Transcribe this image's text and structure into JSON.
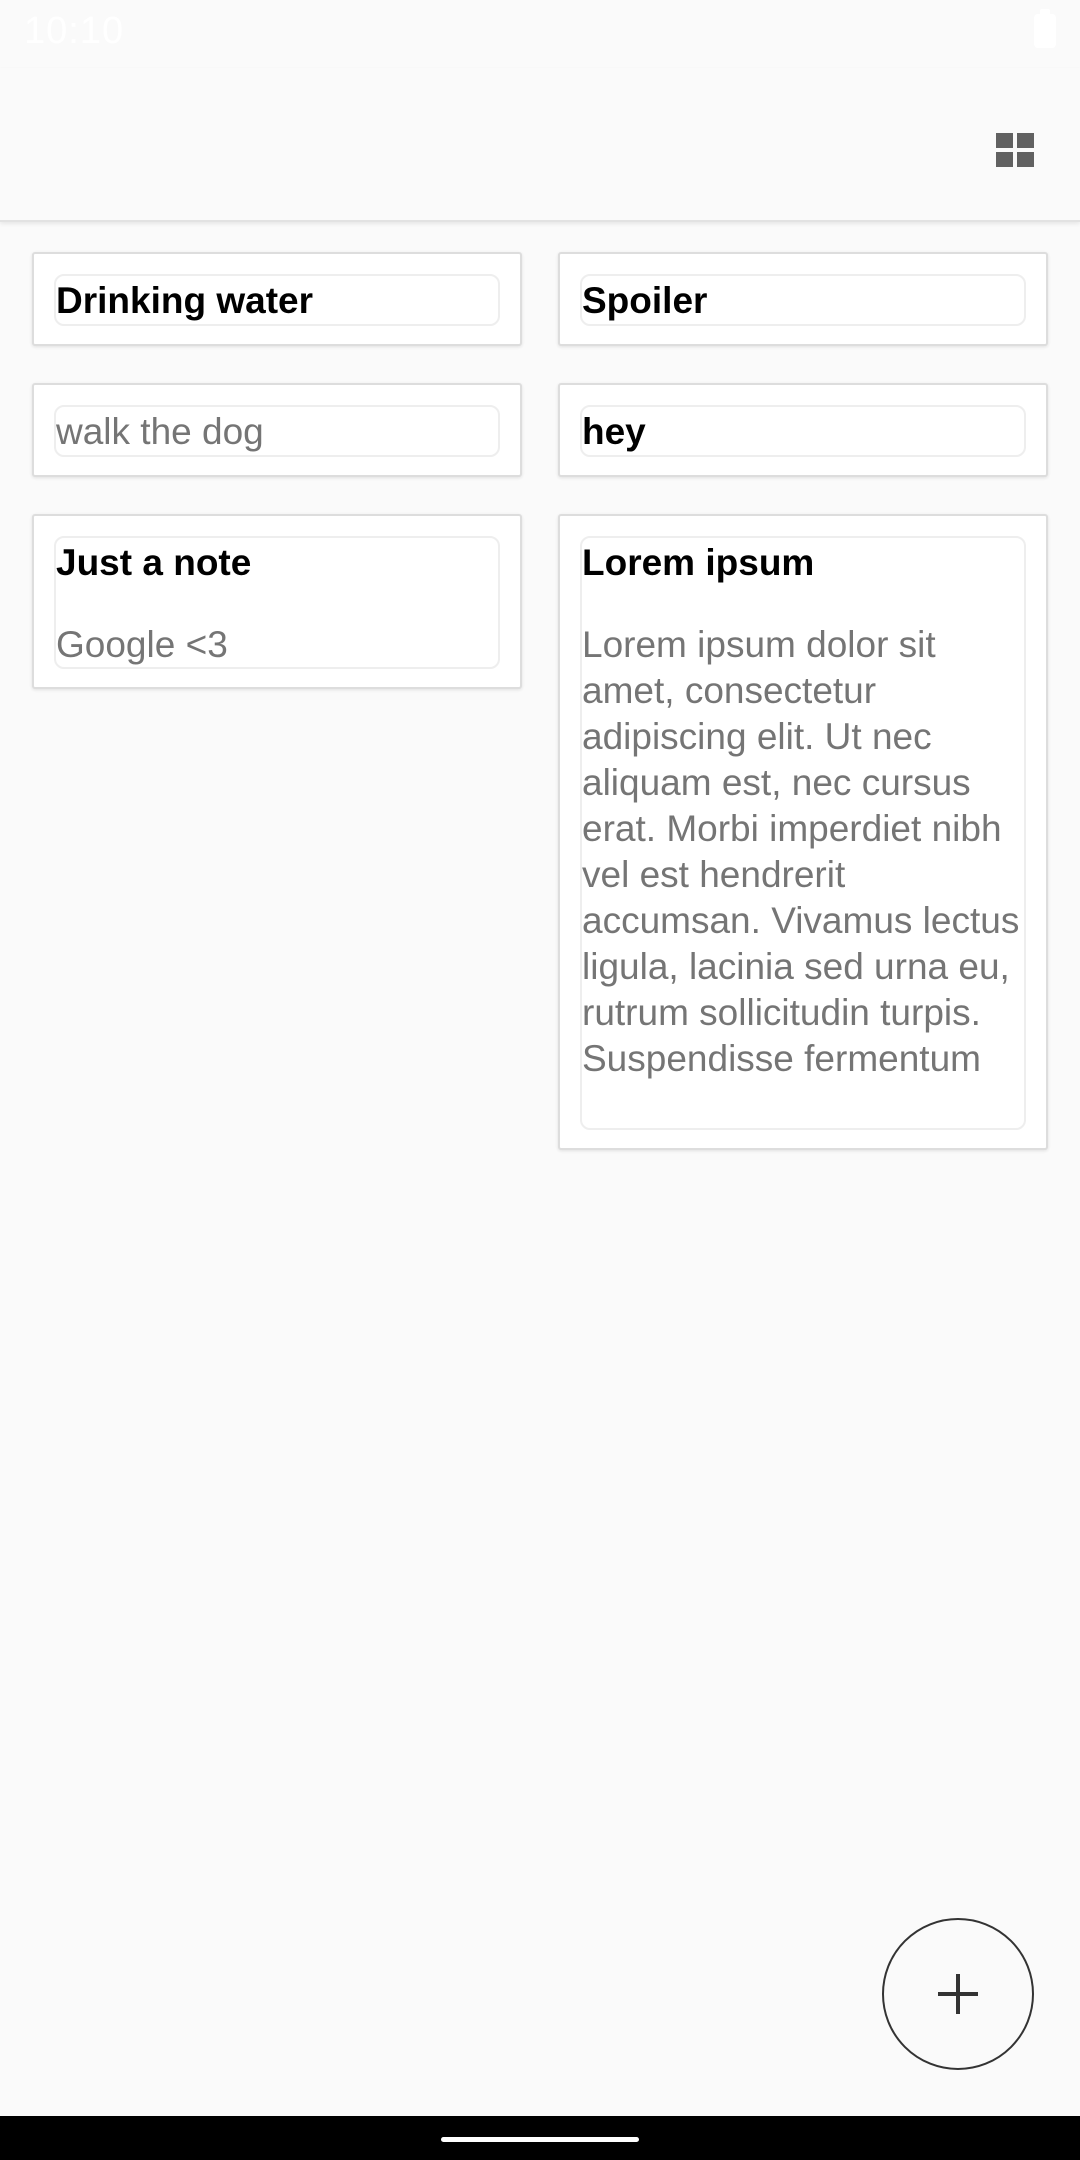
{
  "status_bar": {
    "time": "10:10",
    "battery_icon": "battery-full-icon"
  },
  "app_bar": {
    "view_toggle_icon": "grid-view-icon"
  },
  "notes": [
    {
      "title": "Drinking water",
      "body": ""
    },
    {
      "title": "Spoiler",
      "body": ""
    },
    {
      "title": "",
      "body": "walk the dog"
    },
    {
      "title": "hey",
      "body": ""
    },
    {
      "title": "Just a note",
      "body": "Google <3"
    },
    {
      "title": "Lorem ipsum",
      "body": "Lorem ipsum dolor sit amet, consectetur adipiscing elit. Ut nec aliquam est, nec cursus erat. Morbi imperdiet nibh vel est hendrerit accumsan. Vivamus lectus ligula, lacinia sed urna eu, rutrum sollicitudin turpis. Suspendisse fermentum"
    }
  ],
  "fab": {
    "icon": "plus-icon"
  },
  "colors": {
    "background": "#fafafa",
    "card": "#ffffff",
    "title_text": "#000000",
    "body_text": "#757575",
    "nav_bar": "#000000"
  }
}
